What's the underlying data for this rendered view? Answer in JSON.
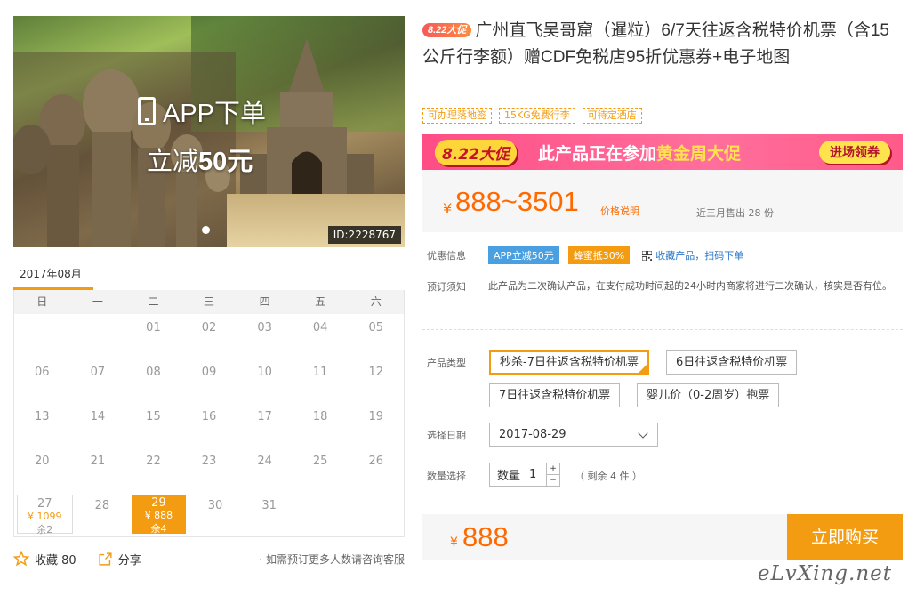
{
  "hero": {
    "promo_line1": "APP下单",
    "promo_line2_prefix": "立减",
    "promo_line2_amount": "50元",
    "id_tag": "ID:2228767"
  },
  "calendar": {
    "month": "2017年08月",
    "weekdays": [
      "日",
      "一",
      "二",
      "三",
      "四",
      "五",
      "六"
    ],
    "rows": [
      [
        "",
        "",
        "01",
        "02",
        "03",
        "04",
        "05"
      ],
      [
        "06",
        "07",
        "08",
        "09",
        "10",
        "11",
        "12"
      ],
      [
        "13",
        "14",
        "15",
        "16",
        "17",
        "18",
        "19"
      ],
      [
        "20",
        "21",
        "22",
        "23",
        "24",
        "25",
        "26"
      ],
      [
        "27",
        "28",
        "29",
        "30",
        "31",
        "",
        ""
      ]
    ],
    "available": {
      "27": {
        "price": "¥ 1099",
        "remain": "余2",
        "selected": false
      },
      "29": {
        "price": "¥ 888",
        "remain": "余4",
        "selected": true
      }
    }
  },
  "actions": {
    "favorite_label": "收藏 80",
    "share_label": "分享",
    "tip": "· 如需预订更多人数请咨询客服"
  },
  "product": {
    "badge": "8.22大促",
    "title": "广州直飞吴哥窟（暹粒）6/7天往返含税特价机票（含15公斤行李额）赠CDF免税店95折优惠券+电子地图",
    "tags": [
      "可办理落地签",
      "15KG免费行李",
      "可待定酒店"
    ]
  },
  "banner": {
    "logo": "8.22大促",
    "text_prefix": "此产品正在参加",
    "text_highlight": "黄金周大促",
    "button": "进场领券"
  },
  "price": {
    "currency": "¥",
    "range": "888~3501",
    "note": "价格说明",
    "sold": "近三月售出 28 份"
  },
  "promotions": {
    "label": "优惠信息",
    "tag1": "APP立减50元",
    "tag2": "蜂蜜抵30%",
    "qr_text": "收藏产品，扫码下单"
  },
  "notice": {
    "label": "预订须知",
    "text": "此产品为二次确认产品，在支付成功时间起的24小时内商家将进行二次确认，核实是否有位。"
  },
  "product_type": {
    "label": "产品类型",
    "options": [
      "秒杀-7日往返含税特价机票",
      "6日往返含税特价机票",
      "7日往返含税特价机票",
      "婴儿价（0-2周岁）抱票"
    ]
  },
  "date": {
    "label": "选择日期",
    "value": "2017-08-29"
  },
  "quantity": {
    "label": "数量选择",
    "field_label": "数量",
    "value": "1",
    "plus": "+",
    "minus": "−",
    "remaining": "（ 剩余 4 件 ）"
  },
  "buy": {
    "currency": "¥",
    "price": "888",
    "button": "立即购买"
  },
  "watermark": "eLvXing.net"
}
